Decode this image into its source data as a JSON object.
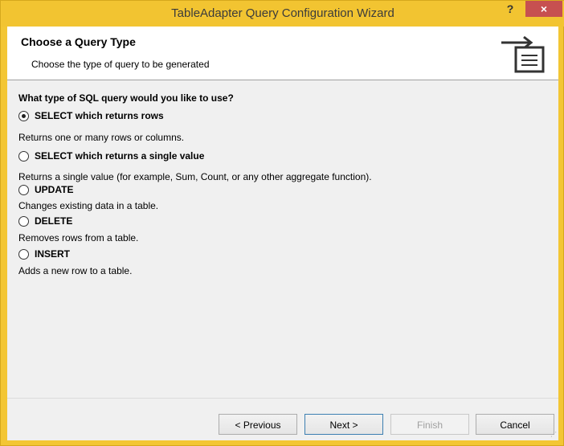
{
  "window": {
    "title": "TableAdapter Query Configuration Wizard",
    "help_label": "?",
    "close_label": "×"
  },
  "header": {
    "title": "Choose a Query Type",
    "subtitle": "Choose the type of query to be generated",
    "icon": "query-wizard-icon"
  },
  "question": "What type of SQL query would you like to use?",
  "options": [
    {
      "label": "SELECT which returns rows",
      "description": "Returns one or many rows or columns.",
      "selected": true
    },
    {
      "label": "SELECT which returns a single value",
      "description": "Returns a single value (for example, Sum, Count, or any other aggregate function).",
      "selected": false
    },
    {
      "label": "UPDATE",
      "description": "Changes existing data in a table.",
      "selected": false
    },
    {
      "label": "DELETE",
      "description": "Removes rows from a table.",
      "selected": false
    },
    {
      "label": "INSERT",
      "description": "Adds a new row to a table.",
      "selected": false
    }
  ],
  "buttons": {
    "previous": "< Previous",
    "next": "Next >",
    "finish": "Finish",
    "cancel": "Cancel"
  },
  "colors": {
    "titlebar": "#f2c431",
    "close_button": "#c75050",
    "dialog_background": "#f0f0f0"
  }
}
